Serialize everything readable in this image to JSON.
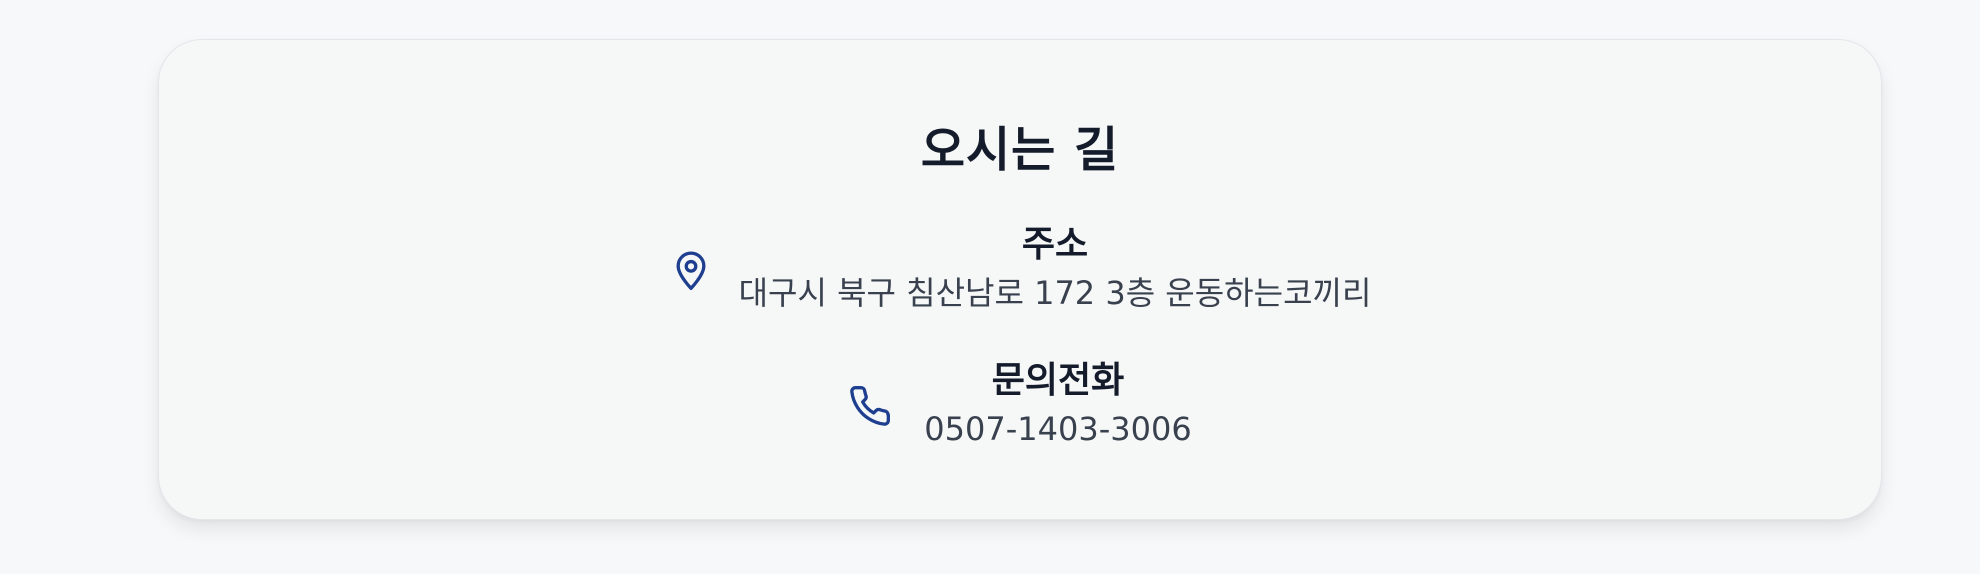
{
  "section": {
    "title": "오시는 길"
  },
  "contact": {
    "address": {
      "icon": "map-pin-icon",
      "label": "주소",
      "value": "대구시 북구 침산남로 172 3층 운동하는코끼리"
    },
    "phone": {
      "icon": "phone-icon",
      "label": "문의전화",
      "value": "0507-1403-3006"
    }
  },
  "colors": {
    "icon": "#1e3f8f",
    "heading": "#141b2b",
    "body_text": "#39414f",
    "card_background": "#f6f7f7",
    "page_background": "#f7f8fa"
  }
}
